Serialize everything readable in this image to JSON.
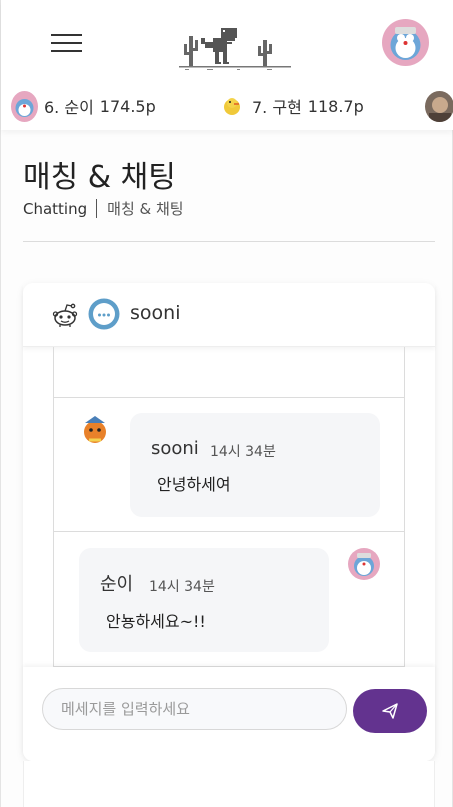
{
  "header": {
    "menu_icon": "hamburger-menu-icon",
    "logo_icon": "dino-cactus-logo-icon",
    "profile_avatar": "doraemon-avatar"
  },
  "ticker": [
    {
      "rank_name": "6. 순이",
      "score": "174.5p",
      "avatar": "doraemon-avatar"
    },
    {
      "rank_name": "7. 구현",
      "score": "118.7p",
      "avatar": "duck-avatar"
    }
  ],
  "page": {
    "title": "매칭 & 채팅",
    "breadcrumb_root": "Chatting",
    "breadcrumb_current": "매칭 & 채팅"
  },
  "chat": {
    "partner_name": "sooni",
    "messages": [
      {
        "sender": "sooni",
        "time": "14시 34분",
        "text": "안녕하세여",
        "side": "left"
      },
      {
        "sender": "순이",
        "time": "14시 34분",
        "text": "안뇽하세요~!!",
        "side": "right"
      }
    ],
    "input_placeholder": "메세지를 입력하세요",
    "send_icon": "paper-plane-icon"
  },
  "colors": {
    "accent": "#63338f",
    "bubble": "#f5f6f8"
  }
}
